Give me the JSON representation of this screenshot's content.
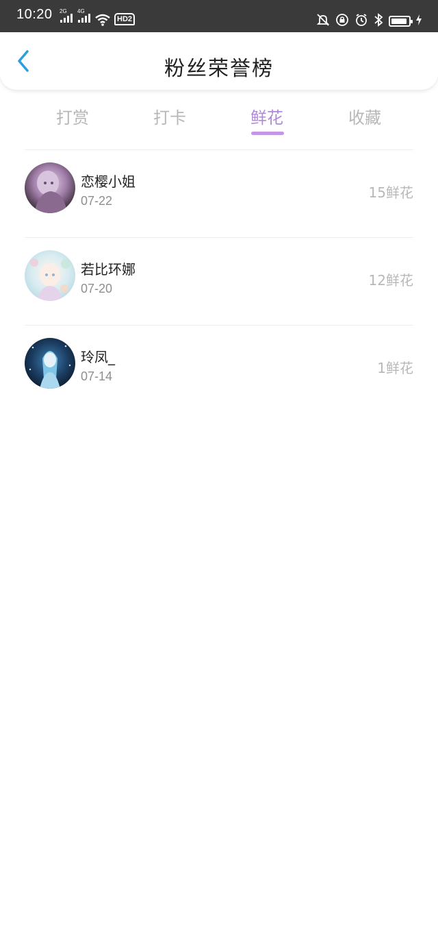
{
  "status": {
    "time": "10:20",
    "net1": "2G",
    "net2": "4G",
    "hd": "HD2",
    "battery_level": 0.8
  },
  "header": {
    "title": "粉丝荣誉榜",
    "back_icon": "chevron-left-icon"
  },
  "tabs": [
    {
      "label": "打赏",
      "active": false
    },
    {
      "label": "打卡",
      "active": false
    },
    {
      "label": "鲜花",
      "active": true
    },
    {
      "label": "收藏",
      "active": false
    }
  ],
  "colors": {
    "accent": "#b08ad9",
    "underline": "#c497e6",
    "back": "#2a9fe0"
  },
  "fans": [
    {
      "name": "恋樱小姐",
      "date": "07-22",
      "amount": "15鲜花",
      "avatar": "anime-avatar-purple"
    },
    {
      "name": "若比环娜",
      "date": "07-20",
      "amount": "12鲜花",
      "avatar": "anime-avatar-pastel"
    },
    {
      "name": "玲凤_",
      "date": "07-14",
      "amount": "1鲜花",
      "avatar": "anime-avatar-blue"
    }
  ]
}
